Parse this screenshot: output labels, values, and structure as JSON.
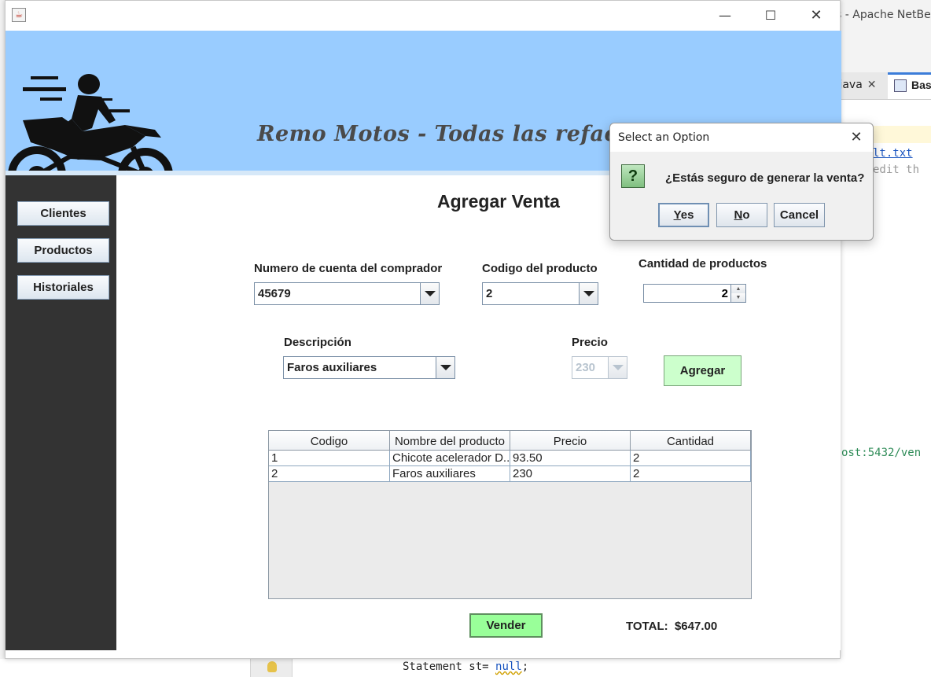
{
  "ide": {
    "title_fragment": "s - Apache NetBea",
    "tab1_label": ".java",
    "tab1_close": "✕",
    "tab2_label": "Bas",
    "code_line1": "lt.txt",
    "code_line2": "edit th",
    "code_line3": "ost:5432/ven",
    "statement_prefix": "Statement st= ",
    "statement_null": "null",
    "statement_suffix": ";"
  },
  "window": {
    "icon": "java-icon",
    "minimize": "—",
    "maximize": "☐",
    "close": "✕"
  },
  "banner": {
    "title": "Remo Motos - Todas las refacciones para tu Moto",
    "logo": "motorcycle-rider-logo"
  },
  "sidebar": {
    "items": [
      {
        "label": "Clientes"
      },
      {
        "label": "Productos"
      },
      {
        "label": "Historiales"
      }
    ]
  },
  "form": {
    "title": "Agregar Venta",
    "cuenta_label": "Numero de cuenta del comprador",
    "cuenta_value": "45679",
    "codigo_label": "Codigo del producto",
    "codigo_value": "2",
    "cantidad_label": "Cantidad de productos",
    "cantidad_value": "2",
    "descripcion_label": "Descripción",
    "descripcion_value": "Faros auxiliares",
    "precio_label": "Precio",
    "precio_value": "230",
    "agregar_label": "Agregar",
    "vender_label": "Vender",
    "total_label": "TOTAL:",
    "total_value": "$647.00"
  },
  "table": {
    "columns": [
      "Codigo",
      "Nombre del producto",
      "Precio",
      "Cantidad"
    ],
    "rows": [
      [
        "1",
        "Chicote acelerador D...",
        "93.50",
        "2"
      ],
      [
        "2",
        "Faros auxiliares",
        "230",
        "2"
      ]
    ]
  },
  "dialog": {
    "title": "Select an Option",
    "close": "✕",
    "icon": "question-icon",
    "icon_glyph": "?",
    "message": "¿Estás seguro de generar la venta?",
    "yes_mnemonic": "Y",
    "yes_rest": "es",
    "no_mnemonic": "N",
    "no_rest": "o",
    "cancel": "Cancel"
  },
  "colors": {
    "banner": "#99ccff",
    "sidebar": "#333333",
    "green_button": "#ccffcc",
    "vender_button": "#99ff99"
  }
}
